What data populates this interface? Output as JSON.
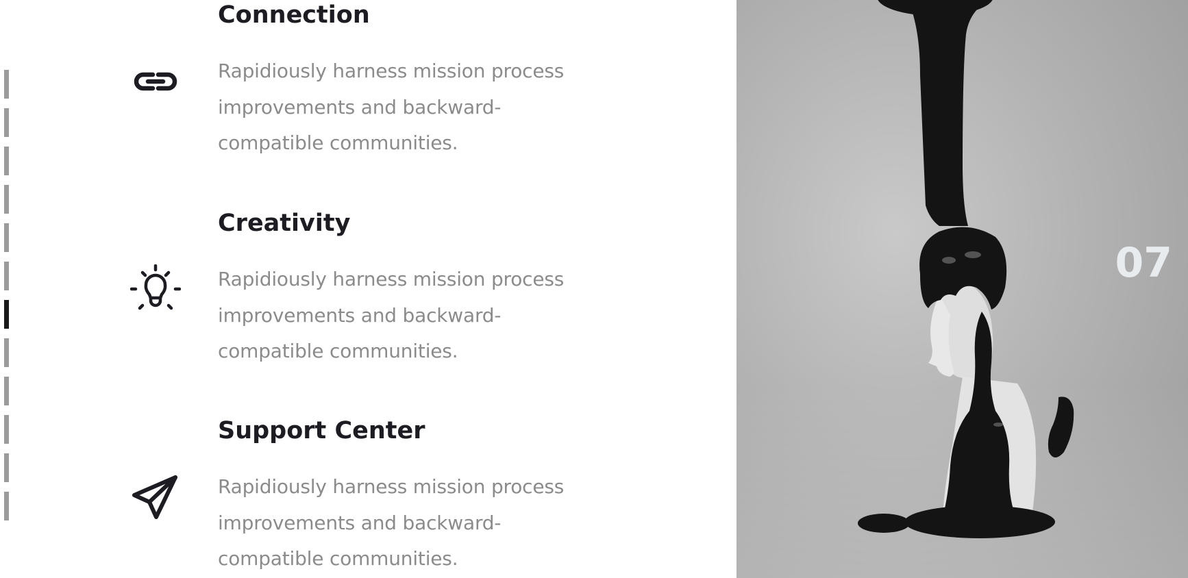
{
  "features": [
    {
      "title": "Connection",
      "description": "Rapidiously harness mission process improvements and backward-compatible communities.",
      "icon": "link-icon"
    },
    {
      "title": "Creativity",
      "description": "Rapidiously harness mission process improvements and backward-compatible communities.",
      "icon": "lightbulb-icon"
    },
    {
      "title": "Support Center",
      "description": "Rapidiously harness mission process improvements and backward-compatible communities.",
      "icon": "paper-plane-icon"
    }
  ],
  "slide_number": "07",
  "pagination": {
    "total": 12,
    "active_index": 6
  },
  "colors": {
    "heading": "#1c1c22",
    "body_text": "#8b8b8b",
    "pagination_inactive": "#9b9b9b",
    "pagination_active": "#1a1a1a",
    "slide_number": "#e9ecef"
  }
}
